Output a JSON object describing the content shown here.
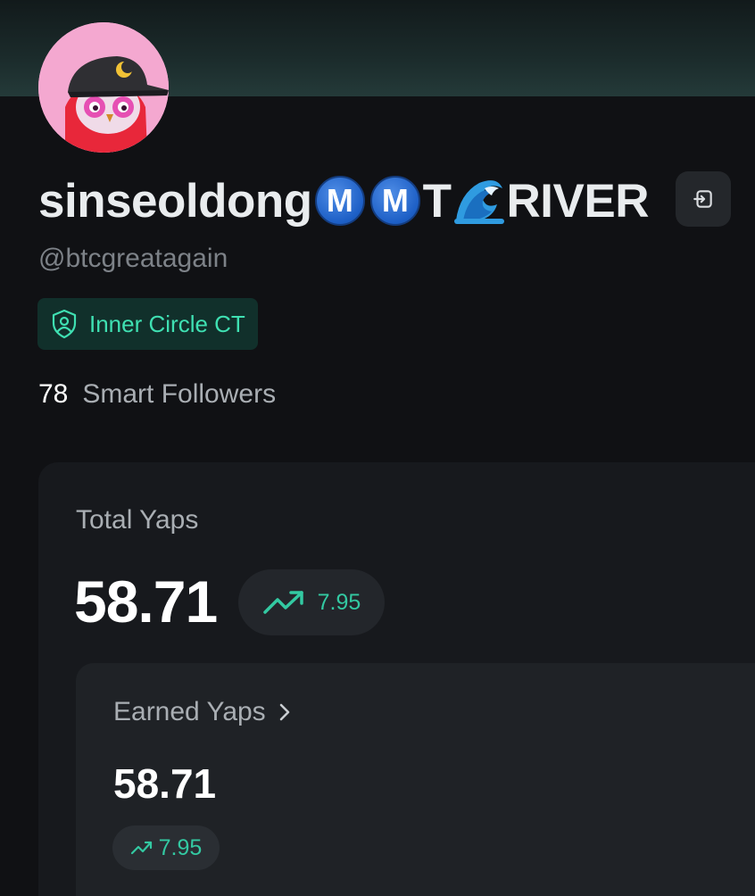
{
  "profile": {
    "name_prefix": "sinseoldong",
    "badge_1": "M",
    "badge_2": "M",
    "name_mid": "T",
    "name_suffix": "RIVER",
    "handle": "@btcgreatagain",
    "tier": "Inner Circle CT",
    "smart_followers_count": "78",
    "smart_followers_label": "Smart Followers"
  },
  "total_yaps": {
    "title": "Total Yaps",
    "value": "58.71",
    "delta": "7.95"
  },
  "earned_yaps": {
    "title": "Earned Yaps",
    "value": "58.71",
    "delta": "7.95"
  },
  "icons": {
    "avatar": "avatar-image",
    "logout": "logout-icon",
    "tier": "shield-user-icon",
    "trend": "trending-up-icon",
    "chevron": "chevron-right-icon",
    "wave": "wave-emoji-icon"
  },
  "colors": {
    "accent": "#3fe0b2",
    "trend": "#33c9a2",
    "background": "#101114",
    "card": "#17191d"
  }
}
